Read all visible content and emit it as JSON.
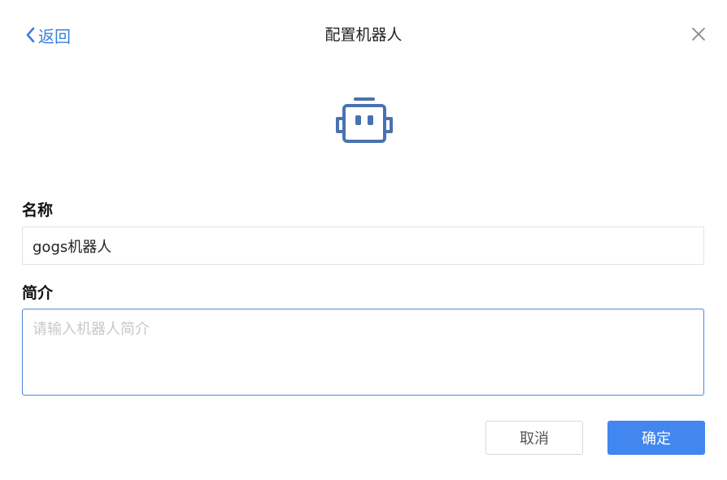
{
  "header": {
    "back_label": "返回",
    "title": "配置机器人",
    "back_icon": "chevron-left-icon",
    "close_icon": "close-icon"
  },
  "avatar": {
    "icon": "robot-icon",
    "color": "#4a72b0"
  },
  "form": {
    "name_label": "名称",
    "name_value": "gogs机器人",
    "intro_label": "简介",
    "intro_value": "",
    "intro_placeholder": "请输入机器人简介"
  },
  "footer": {
    "cancel_label": "取消",
    "confirm_label": "确定"
  },
  "colors": {
    "accent": "#4286f0",
    "link": "#3a7fe0",
    "focus_border": "#4a86e0"
  }
}
